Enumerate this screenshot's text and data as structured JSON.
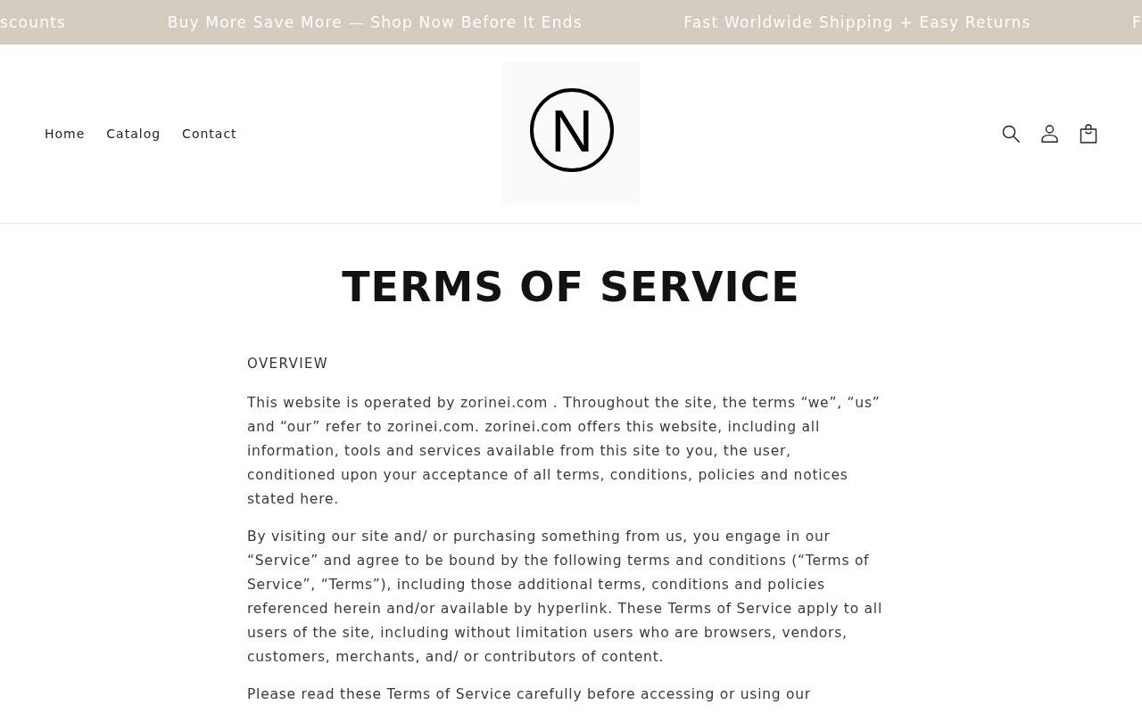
{
  "announcement_bar": {
    "messages": [
      "scounts",
      "Buy More Save More — Shop Now Before It Ends",
      "Fast Worldwide Shipping + Easy Returns",
      "F"
    ]
  },
  "header": {
    "nav": [
      {
        "label": "Home"
      },
      {
        "label": "Catalog"
      },
      {
        "label": "Contact"
      }
    ],
    "logo": {
      "text": "N"
    }
  },
  "page": {
    "title": "TERMS OF SERVICE",
    "heading": "OVERVIEW",
    "paragraphs": [
      "This website is operated by zorinei.com . Throughout the site, the terms “we”, “us” and “our” refer to zorinei.com. zorinei.com offers this website, including all information, tools and services available from this site to you, the user, conditioned upon your acceptance of all terms, conditions, policies and notices stated here.",
      "By visiting our site and/ or purchasing something from us, you engage in our “Service” and agree to be bound by the following terms and conditions (“Terms of Service”, “Terms”), including those additional terms, conditions and policies referenced herein and/or available by hyperlink. These Terms of Service apply to all users of the site, including without limitation users who are browsers, vendors, customers, merchants, and/ or contributors of content.",
      "Please read these Terms of Service carefully before accessing or using our"
    ]
  }
}
